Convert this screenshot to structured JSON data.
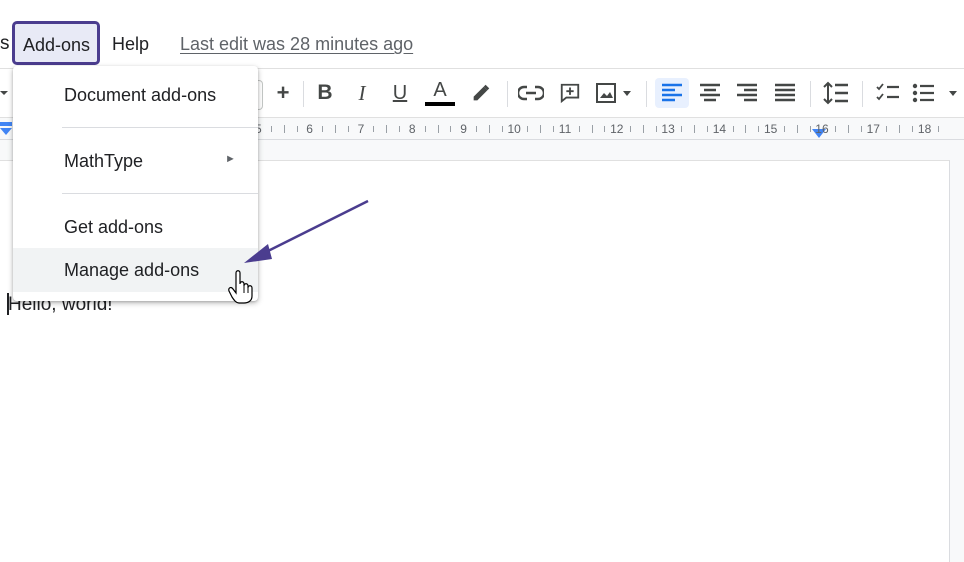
{
  "menubar": {
    "partial_item": "s",
    "addons_label": "Add-ons",
    "help_label": "Help",
    "last_edit": "Last edit was 28 minutes ago"
  },
  "dropdown": {
    "items": [
      {
        "label": "Document add-ons"
      },
      {
        "label": "MathType",
        "submenu_arrow": "►"
      },
      {
        "label": "Get add-ons"
      },
      {
        "label": "Manage add-ons"
      }
    ]
  },
  "toolbar": {
    "icons": [
      "font-size-increase-icon",
      "bold-icon",
      "italic-icon",
      "underline-icon",
      "text-color-icon",
      "highlight-icon",
      "link-icon",
      "comment-icon",
      "image-icon",
      "align-left-icon",
      "align-center-icon",
      "align-right-icon",
      "justify-icon",
      "line-spacing-icon",
      "checklist-icon",
      "bulleted-list-icon"
    ],
    "plus": "+",
    "bold": "B",
    "italic": "I",
    "underline": "U",
    "text_color": "A",
    "text_color_value": "#000000",
    "active_align": "align-left"
  },
  "ruler": {
    "numbers": [
      "5",
      "6",
      "7",
      "8",
      "9",
      "10",
      "11",
      "12",
      "13",
      "14",
      "15",
      "16",
      "17",
      "18"
    ],
    "marker_color": "#4285f4"
  },
  "document": {
    "text": "Hello, world!"
  },
  "colors": {
    "annotation": "#4b3d8f",
    "accent": "#1a73e8"
  }
}
